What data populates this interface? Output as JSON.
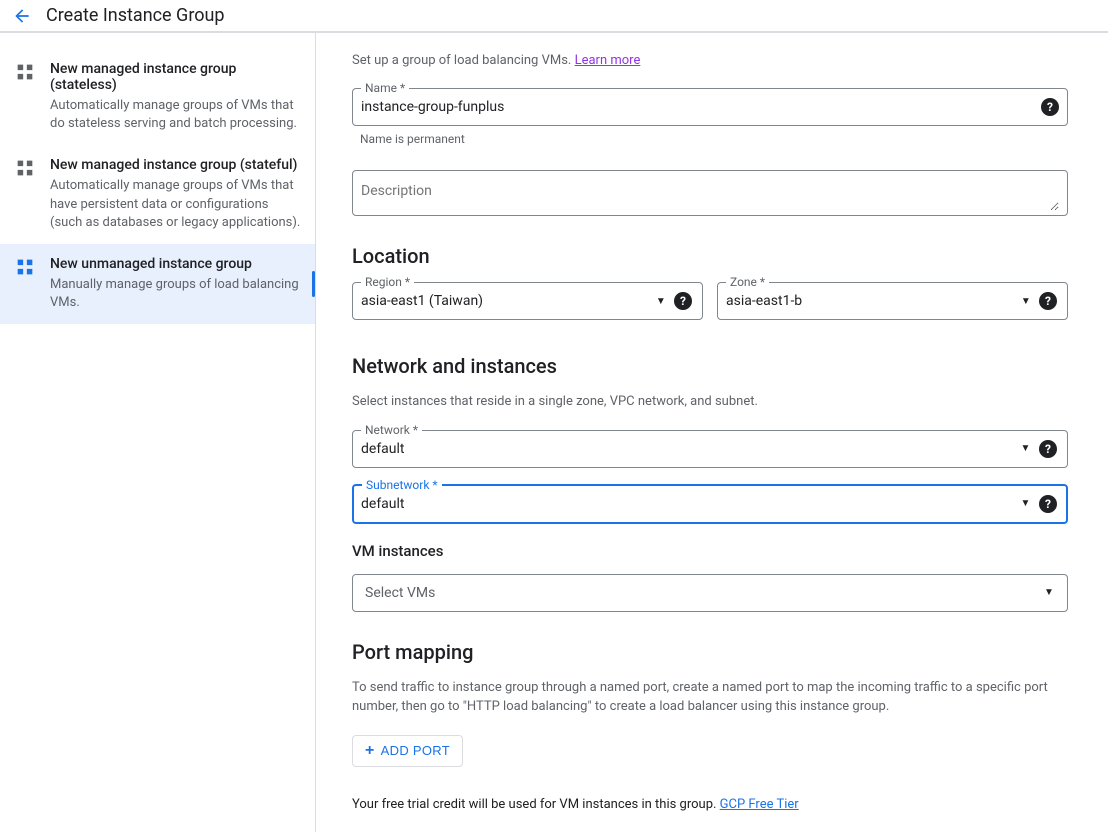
{
  "header": {
    "title": "Create Instance Group"
  },
  "sidebar": {
    "items": [
      {
        "title": "New managed instance group (stateless)",
        "desc": "Automatically manage groups of VMs that do stateless serving and batch processing."
      },
      {
        "title": "New managed instance group (stateful)",
        "desc": "Automatically manage groups of VMs that have persistent data or configurations (such as databases or legacy applications)."
      },
      {
        "title": "New unmanaged instance group",
        "desc": "Manually manage groups of load balancing VMs."
      }
    ]
  },
  "intro": {
    "text": "Set up a group of load balancing VMs.",
    "link": "Learn more"
  },
  "name": {
    "label": "Name *",
    "value": "instance-group-funplus",
    "hint": "Name is permanent"
  },
  "description": {
    "placeholder": "Description"
  },
  "location": {
    "heading": "Location",
    "region": {
      "label": "Region *",
      "value": "asia-east1 (Taiwan)"
    },
    "zone": {
      "label": "Zone *",
      "value": "asia-east1-b"
    }
  },
  "network": {
    "heading": "Network and instances",
    "desc": "Select instances that reside in a single zone, VPC network, and subnet.",
    "network_field": {
      "label": "Network *",
      "value": "default"
    },
    "subnetwork_field": {
      "label": "Subnetwork *",
      "value": "default"
    },
    "vm_heading": "VM instances",
    "vm_placeholder": "Select VMs"
  },
  "port": {
    "heading": "Port mapping",
    "desc": "To send traffic to instance group through a named port, create a named port to map the incoming traffic to a specific port number, then go to \"HTTP load balancing\" to create a load balancer using this instance group.",
    "button": "ADD PORT"
  },
  "footer": {
    "text": "Your free trial credit will be used for VM instances in this group.",
    "link": "GCP Free Tier"
  }
}
